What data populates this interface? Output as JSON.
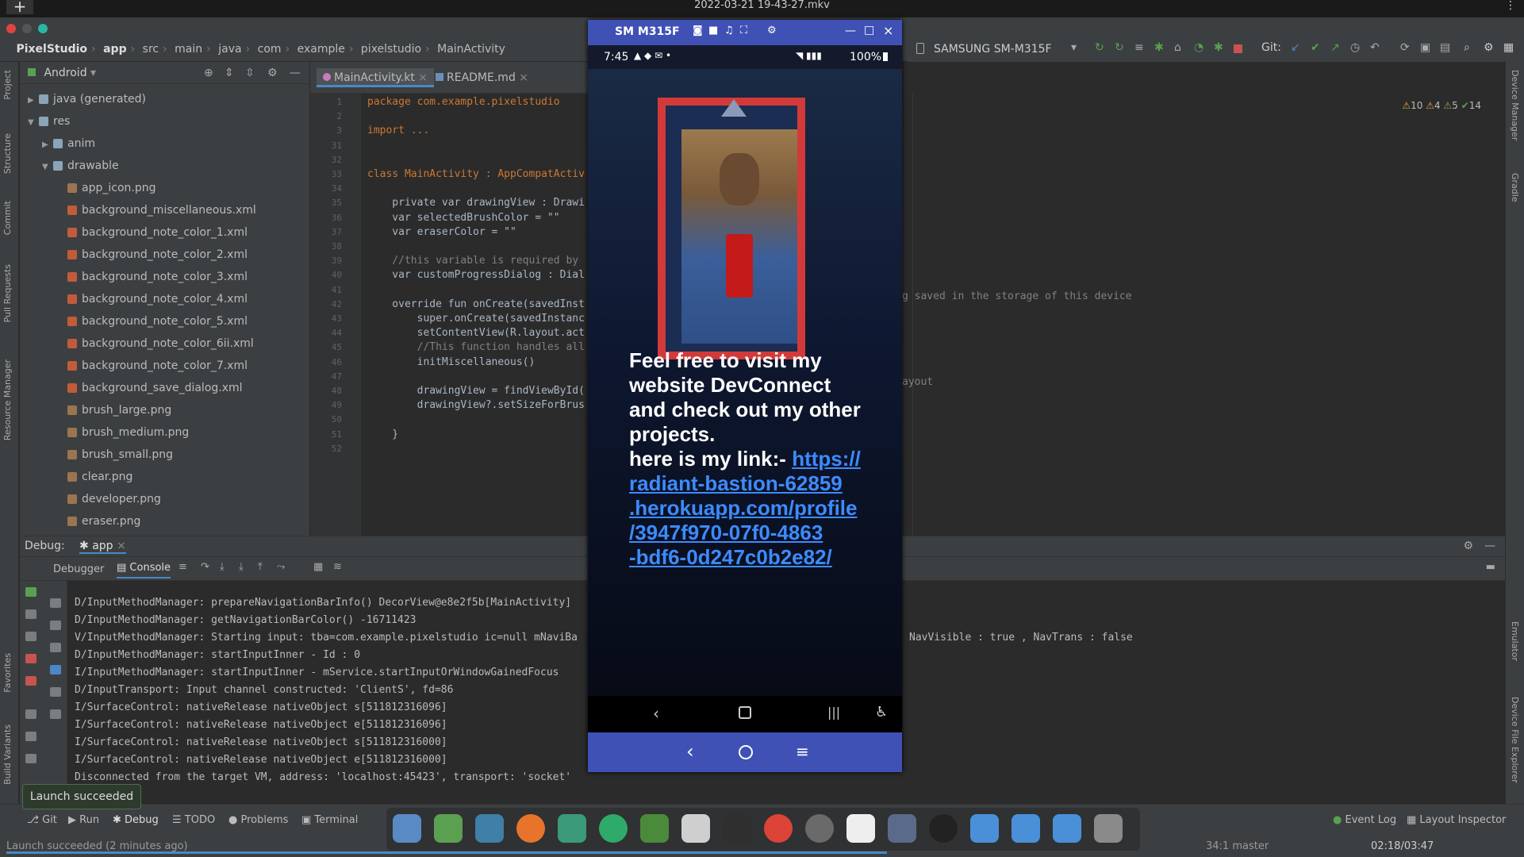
{
  "video": {
    "title": "2022-03-21 19-43-27.mkv"
  },
  "breadcrumb": [
    "PixelStudio",
    "app",
    "src",
    "main",
    "java",
    "com",
    "example",
    "pixelstudio",
    "MainActivity"
  ],
  "toolbar": {
    "device": "SAMSUNG SM-M315F",
    "git_label": "Git:"
  },
  "inspections": {
    "warnings": "10",
    "weak": "4",
    "typos": "5",
    "ok": "14"
  },
  "project": {
    "view": "Android",
    "items": [
      {
        "label": "java (generated)",
        "type": "folder",
        "depth": 1,
        "caret": "▶"
      },
      {
        "label": "res",
        "type": "folder",
        "depth": 1,
        "caret": "▼"
      },
      {
        "label": "anim",
        "type": "folder",
        "depth": 2,
        "caret": "▶"
      },
      {
        "label": "drawable",
        "type": "folder",
        "depth": 2,
        "caret": "▼"
      },
      {
        "label": "app_icon.png",
        "type": "png",
        "depth": 3,
        "caret": ""
      },
      {
        "label": "background_miscellaneous.xml",
        "type": "xml",
        "depth": 3,
        "caret": ""
      },
      {
        "label": "background_note_color_1.xml",
        "type": "xml",
        "depth": 3,
        "caret": ""
      },
      {
        "label": "background_note_color_2.xml",
        "type": "xml",
        "depth": 3,
        "caret": ""
      },
      {
        "label": "background_note_color_3.xml",
        "type": "xml",
        "depth": 3,
        "caret": ""
      },
      {
        "label": "background_note_color_4.xml",
        "type": "xml",
        "depth": 3,
        "caret": ""
      },
      {
        "label": "background_note_color_5.xml",
        "type": "xml",
        "depth": 3,
        "caret": ""
      },
      {
        "label": "background_note_color_6ii.xml",
        "type": "xml",
        "depth": 3,
        "caret": ""
      },
      {
        "label": "background_note_color_7.xml",
        "type": "xml",
        "depth": 3,
        "caret": ""
      },
      {
        "label": "background_save_dialog.xml",
        "type": "xml",
        "depth": 3,
        "caret": ""
      },
      {
        "label": "brush_large.png",
        "type": "png",
        "depth": 3,
        "caret": ""
      },
      {
        "label": "brush_medium.png",
        "type": "png",
        "depth": 3,
        "caret": ""
      },
      {
        "label": "brush_small.png",
        "type": "png",
        "depth": 3,
        "caret": ""
      },
      {
        "label": "clear.png",
        "type": "png",
        "depth": 3,
        "caret": ""
      },
      {
        "label": "developer.png",
        "type": "png",
        "depth": 3,
        "caret": ""
      },
      {
        "label": "eraser.png",
        "type": "png",
        "depth": 3,
        "caret": ""
      }
    ]
  },
  "tabs": [
    {
      "label": "MainActivity.kt"
    },
    {
      "label": "README.md"
    }
  ],
  "code": {
    "lines": [
      {
        "n": "1",
        "t": "package com.example.pixelstudio"
      },
      {
        "n": "2",
        "t": ""
      },
      {
        "n": "3",
        "t": "import ..."
      },
      {
        "n": "31",
        "t": ""
      },
      {
        "n": "32",
        "t": ""
      },
      {
        "n": "33",
        "t": "class MainActivity : AppCompatActiv"
      },
      {
        "n": "34",
        "t": ""
      },
      {
        "n": "35",
        "t": "    private var drawingView : Drawi"
      },
      {
        "n": "36",
        "t": "    var selectedBrushColor = \"\""
      },
      {
        "n": "37",
        "t": "    var eraserColor = \"\""
      },
      {
        "n": "38",
        "t": ""
      },
      {
        "n": "39",
        "t": "    //this variable is required by"
      },
      {
        "n": "40",
        "t": "    var customProgressDialog : Dial"
      },
      {
        "n": "41",
        "t": ""
      },
      {
        "n": "42",
        "t": "    override fun onCreate(savedInst"
      },
      {
        "n": "43",
        "t": "        super.onCreate(savedInstanc"
      },
      {
        "n": "44",
        "t": "        setContentView(R.layout.act"
      },
      {
        "n": "45",
        "t": "        //This function handles all"
      },
      {
        "n": "46",
        "t": "        initMiscellaneous()"
      },
      {
        "n": "47",
        "t": ""
      },
      {
        "n": "48",
        "t": "        drawingView = findViewById("
      },
      {
        "n": "49",
        "t": "        drawingView?.setSizeForBrus"
      },
      {
        "n": "50",
        "t": ""
      },
      {
        "n": "51",
        "t": "    }"
      },
      {
        "n": "52",
        "t": ""
      }
    ],
    "right_39": "g saved in the storage of this device",
    "right_45": "ayout"
  },
  "debug": {
    "label": "Debug:",
    "config": "app",
    "tab_debugger": "Debugger",
    "tab_console": "Console"
  },
  "console": [
    "D/InputMethodManager: prepareNavigationBarInfo() DecorView@e8e2f5b[MainActivity]",
    "D/InputMethodManager: getNavigationBarColor() -16711423",
    "V/InputMethodManager: Starting input: tba=com.example.pixelstudio ic=null mNaviBa",
    "D/InputMethodManager: startInputInner - Id : 0",
    "I/InputMethodManager: startInputInner - mService.startInputOrWindowGainedFocus",
    "D/InputTransport: Input channel constructed: 'ClientS', fd=86",
    "I/SurfaceControl: nativeRelease nativeObject s[511812316096]",
    "I/SurfaceControl: nativeRelease nativeObject e[511812316096]",
    "I/SurfaceControl: nativeRelease nativeObject s[511812316000]",
    "I/SurfaceControl: nativeRelease nativeObject e[511812316000]",
    "Disconnected from the target VM, address: 'localhost:45423', transport: 'socket'"
  ],
  "console_right_3": "NavVisible : true , NavTrans : false",
  "bottom_tabs": [
    "Git",
    "Run",
    "Debug",
    "TODO",
    "Problems",
    "Terminal"
  ],
  "bottom_right": [
    "Event Log",
    "Layout Inspector"
  ],
  "toast": "Launch succeeded",
  "status": {
    "left": "Launch succeeded (2 minutes ago)",
    "right": "34:1   master",
    "time": "02:18/03:47"
  },
  "phone": {
    "window_title": "SM M315F",
    "time": "7:45",
    "battery": "100%",
    "text_lines": [
      "Feel free to visit my",
      "website DevConnect",
      "and check out my other",
      "projects.",
      "here is my link:- "
    ],
    "link_lines": [
      "https://",
      "radiant-bastion-62859",
      ".herokuapp.com/profile",
      "/3947f970-07f0-4863",
      "-bdf6-0d247c0b2e82/"
    ]
  },
  "side_labels_left": [
    "Project",
    "Structure",
    "Commit",
    "Pull Requests",
    "Resource Manager",
    "Favorites",
    "Build Variants"
  ],
  "side_labels_right": [
    "Device Manager",
    "Gradle",
    "Emulator",
    "Device File Explorer"
  ],
  "colors": {
    "accent": "#4a88c7",
    "phone_bar": "#3f51b5",
    "link": "#3d8bff"
  }
}
